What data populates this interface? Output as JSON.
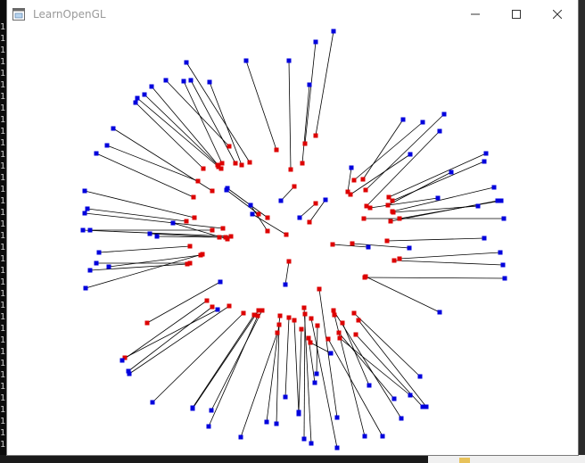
{
  "window": {
    "title": "LearnOpenGL",
    "icon": "application-window-icon",
    "buttons": {
      "minimize": "minimize-icon",
      "maximize": "maximize-icon",
      "close": "close-icon"
    }
  },
  "scene": {
    "background_color": "#ffffff",
    "line_color": "#000000",
    "start_point_color": "#dd0000",
    "end_point_color": "#0000dd"
  },
  "background": {
    "console_digit": "1"
  }
}
